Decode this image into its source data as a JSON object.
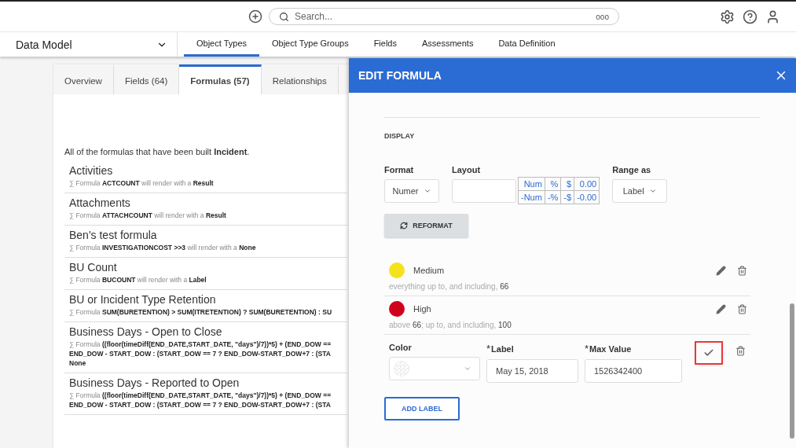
{
  "top_bar": {
    "search": {
      "placeholder": "Search..."
    },
    "search_more": "ooo"
  },
  "nav": {
    "module": "Data Model",
    "tabs": [
      {
        "label": "Object Types",
        "selected": true
      },
      {
        "label": "Object Type Groups",
        "selected": false
      },
      {
        "label": "Fields",
        "selected": false
      },
      {
        "label": "Assessments",
        "selected": false
      },
      {
        "label": "Data Definition",
        "selected": false
      }
    ]
  },
  "object_tabs": [
    {
      "label": "Overview",
      "selected": false
    },
    {
      "label": "Fields (64)",
      "selected": false
    },
    {
      "label": "Formulas (57)",
      "selected": true
    },
    {
      "label": "Relationships",
      "selected": false
    }
  ],
  "intro": "All of the formulas that have been built **Incident**.",
  "formulas": [
    {
      "name": "Activities",
      "lines": [
        {
          "text": "∑ Formula **ACTCOUNT** will render with a **Result**",
          "strong": false
        }
      ]
    },
    {
      "name": "Attachments",
      "lines": [
        {
          "text": "∑ Formula **ATTACHCOUNT** will render with a **Result**",
          "strong": false
        }
      ]
    },
    {
      "name": "Ben's test formula",
      "lines": [
        {
          "text": "∑ Formula **INVESTIGATIONCOST >>3** will render with a **None**",
          "strong": false
        }
      ]
    },
    {
      "name": "BU Count",
      "lines": [
        {
          "text": "∑ Formula **BUCOUNT** will render with a **Label**",
          "strong": false
        }
      ]
    },
    {
      "name": "BU or Incident Type Retention",
      "lines": [
        {
          "text": "∑ Formula **SUM(BURETENTION) > SUM(ITRETENTION) ? SUM(BURETENTION) : SU**",
          "strong": false
        }
      ]
    },
    {
      "name": "Business Days - Open to Close",
      "lines": [
        {
          "text": "∑ Formula **((floor(timeDiff(END_DATE,START_DATE, \"days\")/7))*5) + (END_DOW ==**",
          "strong": false
        },
        {
          "text": "END_DOW - START_DOW : (START_DOW == 7 ? END_DOW-START_DOW+7 : (STA",
          "strong": true
        },
        {
          "text": "None",
          "strong": true
        }
      ]
    },
    {
      "name": "Business Days - Reported to Open",
      "lines": [
        {
          "text": "∑ Formula **((floor(timeDiff(END_DATE,START_DATE, \"days\")/7))*5) + (END_DOW ==**",
          "strong": false
        },
        {
          "text": "END_DOW - START_DOW : (START_DOW == 7 ? END_DOW-START_DOW+7 : (STA",
          "strong": true
        }
      ]
    }
  ],
  "drawer": {
    "title": "EDIT FORMULA",
    "section": "DISPLAY",
    "format": {
      "label": "Format",
      "value": "Numer"
    },
    "layout": {
      "label": "Layout"
    },
    "preview": [
      [
        "Num",
        "%",
        "$",
        "0.00"
      ],
      [
        "-Num",
        "-%",
        "-$",
        "-0.00"
      ]
    ],
    "range_as": {
      "label": "Range as",
      "value": "Label"
    },
    "reformat": "REFORMAT",
    "ranges": [
      {
        "name": "Medium",
        "color": "#f5e21c",
        "description": "everything up to, and including, **66**"
      },
      {
        "name": "High",
        "color": "#d0021b",
        "description": "above **66**; up to, and including, **100**"
      }
    ],
    "editor": {
      "required_mark": "*",
      "fields": [
        {
          "kind": "color",
          "label": "Color",
          "required": false
        },
        {
          "kind": "text",
          "label": "Label",
          "required": true,
          "value": "May 15, 2018"
        },
        {
          "kind": "text",
          "label": "Max Value",
          "required": true,
          "value": "1526342400"
        }
      ],
      "confirm_highlighted": true
    },
    "add_label": "ADD LABEL"
  }
}
